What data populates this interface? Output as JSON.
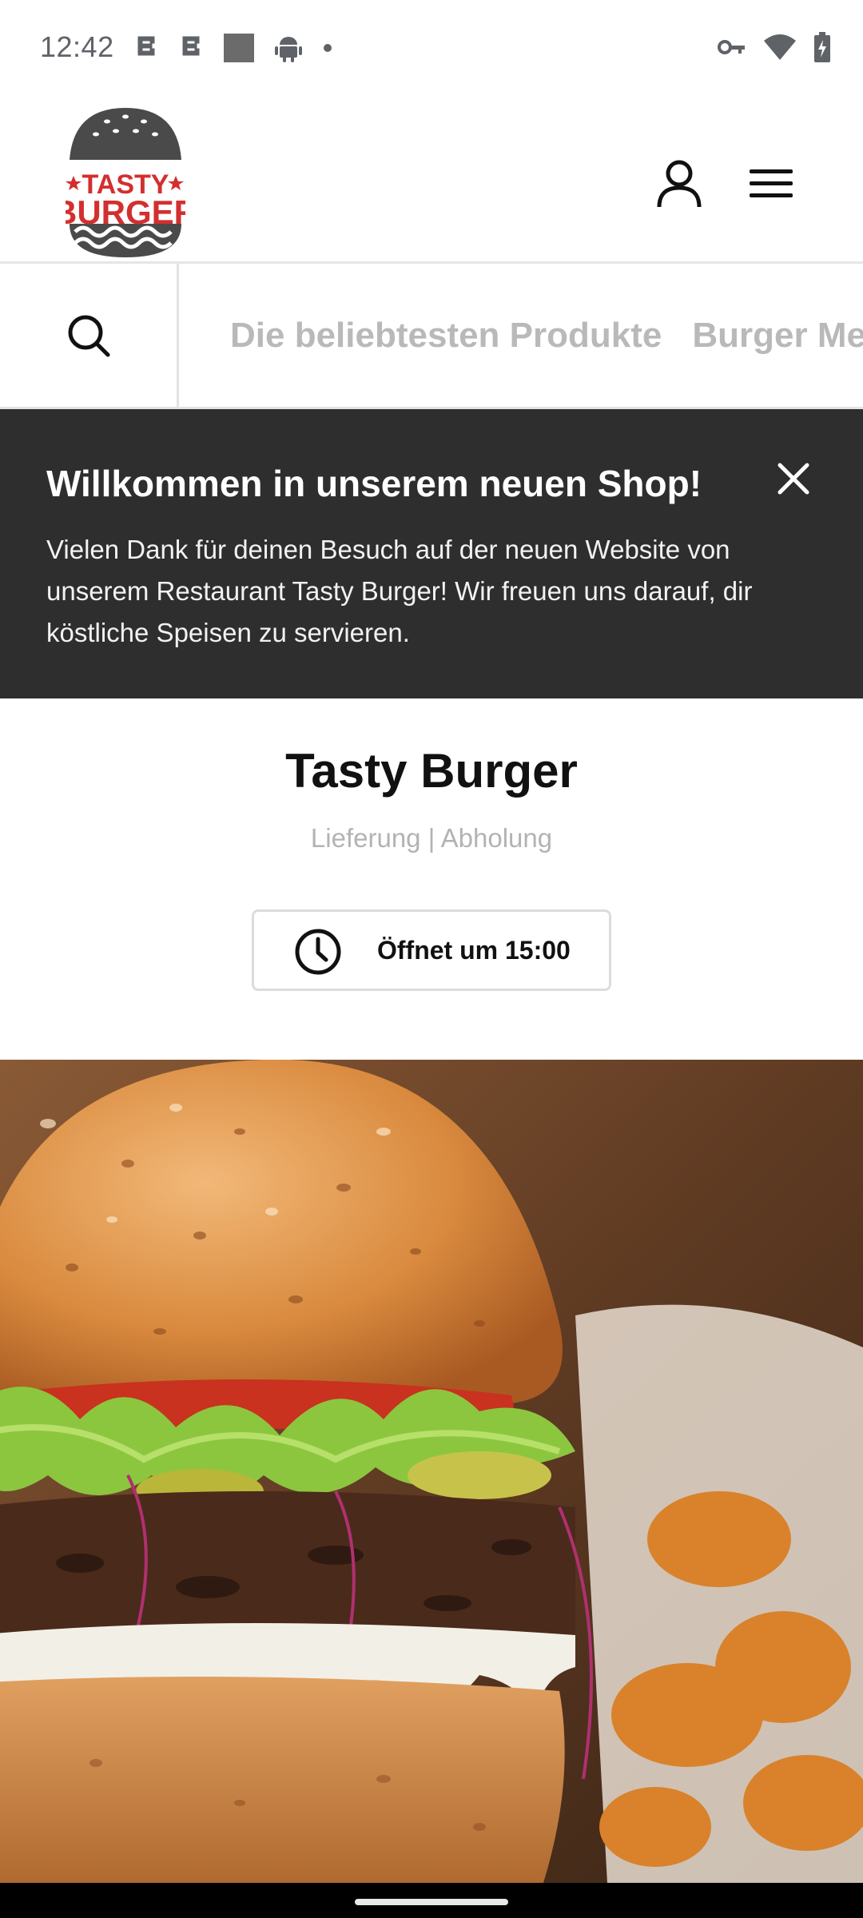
{
  "status_bar": {
    "time": "12:42",
    "left_icons": [
      "notification-icon",
      "notification-icon",
      "image-icon",
      "android-icon",
      "dot-icon"
    ],
    "right_icons": [
      "vpn-key-icon",
      "wifi-icon",
      "battery-icon"
    ]
  },
  "header": {
    "logo_alt": "Tasty Burger logo",
    "logo_text_top": "TASTY",
    "logo_text_bottom": "BURGER",
    "user_icon": "user-icon",
    "menu_icon": "hamburger-menu-icon"
  },
  "category_nav": {
    "search_icon": "search-icon",
    "tabs": [
      {
        "label": "Die beliebtesten Produkte"
      },
      {
        "label": "Burger Me"
      }
    ]
  },
  "banner": {
    "title": "Willkommen in unserem neuen Shop!",
    "text": "Vielen Dank für deinen Besuch auf der neuen Website von unserem Restaurant Tasty Burger! Wir freuen uns darauf, dir köstliche Speisen zu servieren.",
    "close_icon": "close-icon"
  },
  "store": {
    "title": "Tasty Burger",
    "subtitle": "Lieferung | Abholung",
    "opening_label": "Öffnet um 15:00",
    "opening_icon": "clock-icon"
  },
  "hero": {
    "alt": "Burger mit Salat, Tomate, Gurken und Pommes"
  },
  "colors": {
    "logo_red": "#d32f2f",
    "logo_dark": "#4a4a4a",
    "banner_bg": "#2e2e2e",
    "tab_text": "#b9b9b9"
  }
}
